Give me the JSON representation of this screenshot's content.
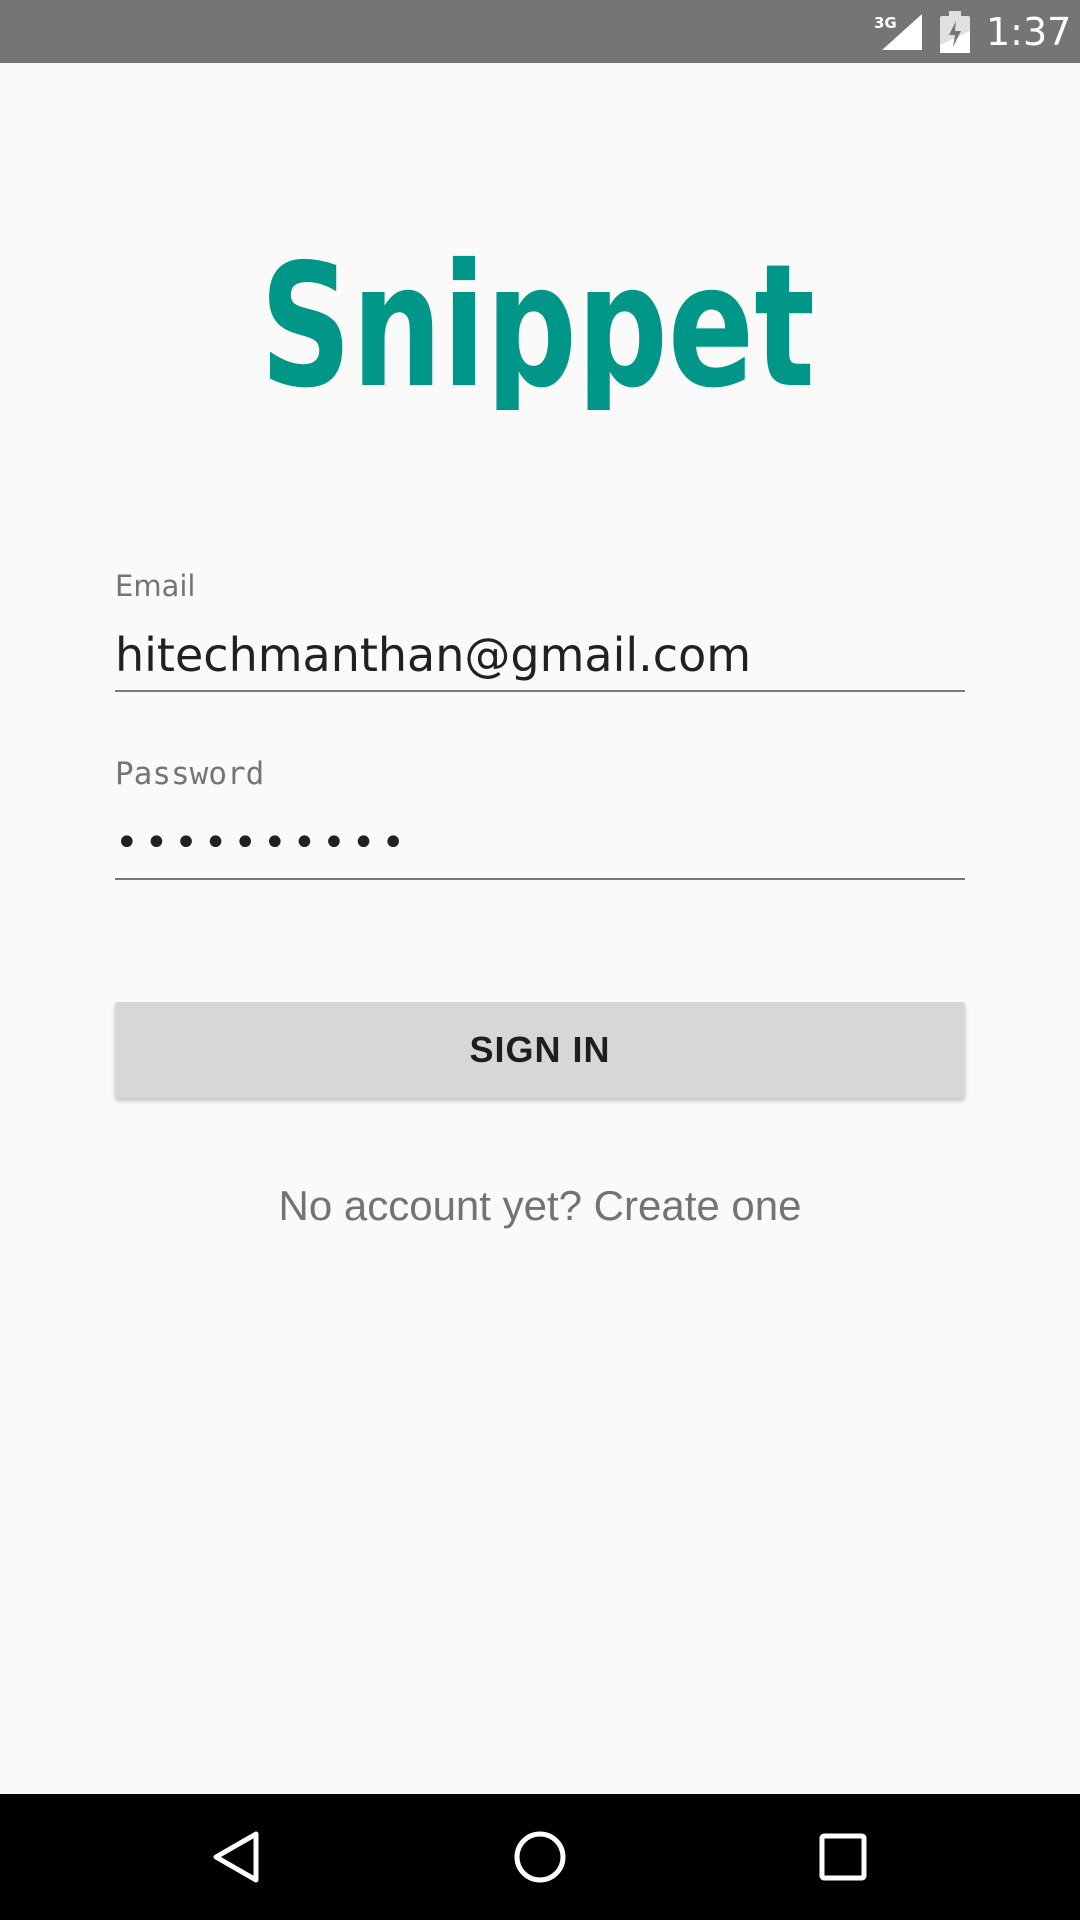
{
  "status_bar": {
    "network": "3G",
    "time": "1:37",
    "icons": [
      "signal-icon",
      "battery-icon"
    ]
  },
  "logo": {
    "text": "Snippet",
    "color": "#009688"
  },
  "login_form": {
    "email": {
      "label": "Email",
      "value": "hitechmanthan@gmail.com"
    },
    "password": {
      "label": "Password",
      "value": "••••••••••"
    },
    "sign_in_button": "SIGN IN",
    "create_account_link": "No account yet? Create one"
  },
  "nav_bar": {
    "icons": [
      "back-icon",
      "home-icon",
      "recents-icon"
    ]
  },
  "colors": {
    "status_bar": "#757575",
    "background": "#fafafa",
    "accent": "#009688",
    "button": "#d6d7d7",
    "nav_bar": "#000000"
  }
}
